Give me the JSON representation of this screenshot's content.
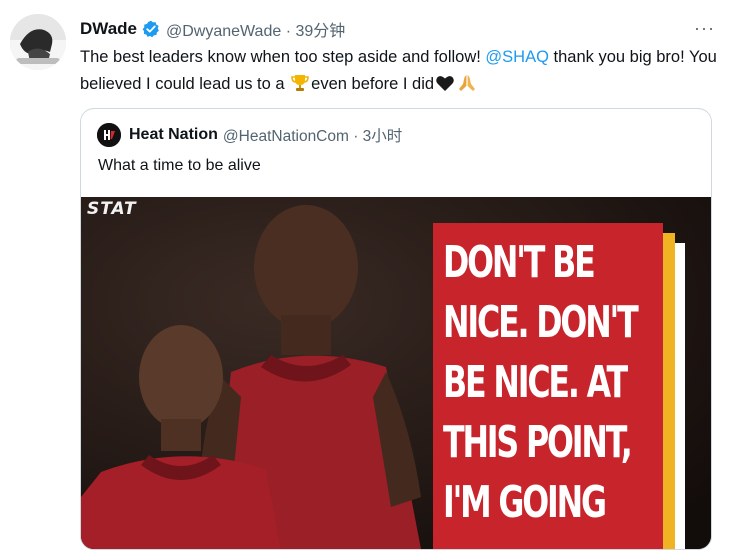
{
  "tweet": {
    "display_name": "DWade",
    "handle_time": "@DwyaneWade · 39分钟",
    "text_part1": "The best leaders know when too step aside and follow! ",
    "mention": "@SHAQ",
    "text_part2": " thank you big bro! You believed I could lead us to a ",
    "text_part3": "even before I did",
    "more_label": "···",
    "emojis": [
      "trophy-icon",
      "black-heart-icon",
      "folded-hands-icon"
    ]
  },
  "quote": {
    "display_name": "Heat Nation",
    "handle_time": "@HeatNationCom · 3小时",
    "text": "What a time to be alive",
    "media": {
      "watermark": "STAT",
      "poster_lines": [
        "DON'T BE",
        "NICE. DON'T",
        "BE NICE. AT",
        "THIS POINT,",
        "I'M GOING"
      ],
      "poster_color": "#c8242b",
      "stripe_color": "#f0b323"
    }
  },
  "colors": {
    "accent": "#1d9bf0",
    "secondary_text": "#536471",
    "border": "#cfd9de"
  }
}
